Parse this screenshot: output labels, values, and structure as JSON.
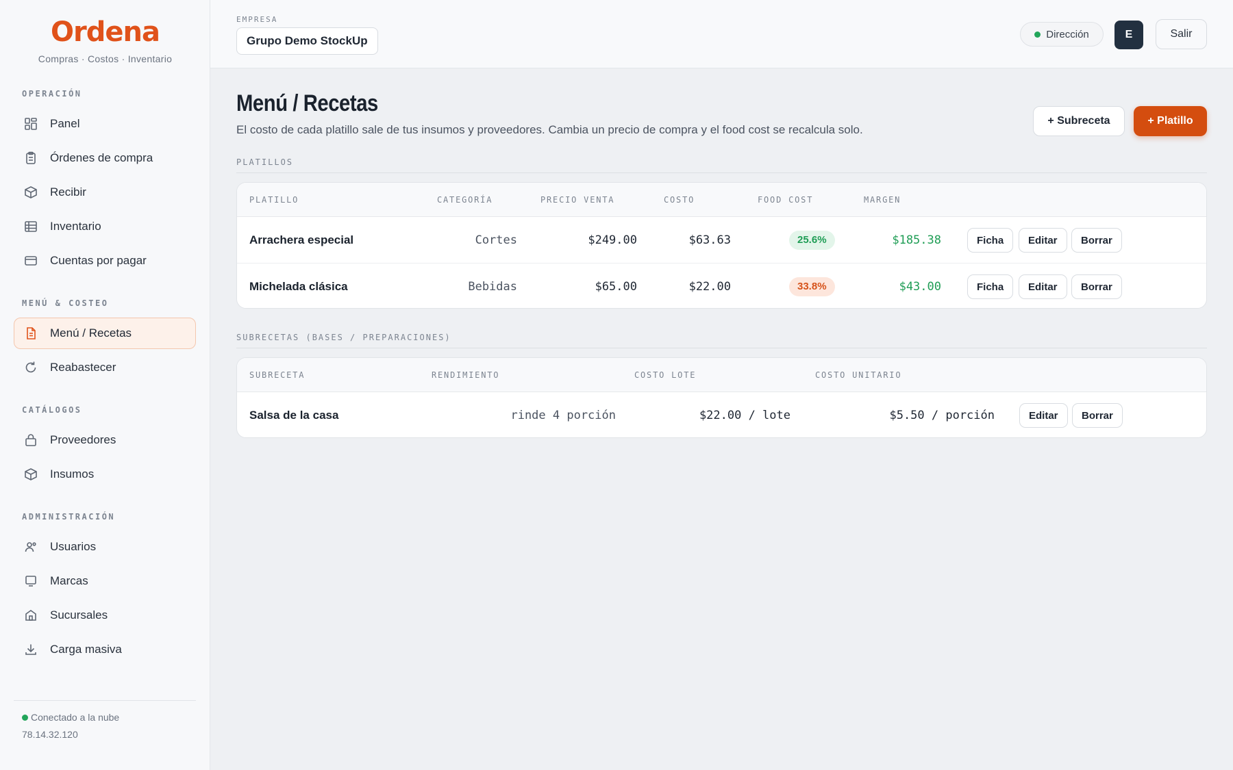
{
  "app": {
    "logo": "Ordena",
    "tagline": "Compras · Costos · Inventario"
  },
  "sidebar": {
    "sections": [
      {
        "label": "OPERACIÓN",
        "items": [
          "Panel",
          "Órdenes de compra",
          "Recibir",
          "Inventario",
          "Cuentas por pagar"
        ]
      },
      {
        "label": "MENÚ & COSTEO",
        "items": [
          "Menú / Recetas",
          "Reabastecer"
        ]
      },
      {
        "label": "CATÁLOGOS",
        "items": [
          "Proveedores",
          "Insumos"
        ]
      },
      {
        "label": "ADMINISTRACIÓN",
        "items": [
          "Usuarios",
          "Marcas",
          "Sucursales",
          "Carga masiva"
        ]
      }
    ],
    "active_item": "Menú / Recetas",
    "status": "Conectado a la nube",
    "ip": "78.14.32.120"
  },
  "topbar": {
    "empresa_label": "EMPRESA",
    "empresa_value": "Grupo Demo StockUp",
    "role": "Dirección",
    "avatar_initial": "E",
    "logout": "Salir"
  },
  "main": {
    "title": "Menú / Recetas",
    "subtitle": "El costo de cada platillo sale de tus insumos y proveedores. Cambia un precio de compra y el food cost se recalcula solo.",
    "add_subrecipe": "+ Subreceta",
    "add_dish": "+ Platillo",
    "dishes": {
      "label": "PLATILLOS",
      "columns": [
        "PLATILLO",
        "CATEGORÍA",
        "PRECIO VENTA",
        "COSTO",
        "FOOD COST",
        "MARGEN"
      ],
      "rows": [
        {
          "name": "Arrachera especial",
          "category": "Cortes",
          "price": "$249.00",
          "cost": "$63.63",
          "food_cost": "25.6%",
          "food_cost_status": "good",
          "margin": "$185.38"
        },
        {
          "name": "Michelada clásica",
          "category": "Bebidas",
          "price": "$65.00",
          "cost": "$22.00",
          "food_cost": "33.8%",
          "food_cost_status": "warn",
          "margin": "$43.00"
        }
      ],
      "actions": [
        "Ficha",
        "Editar",
        "Borrar"
      ]
    },
    "subrecipes": {
      "label": "SUBRECETAS (BASES / PREPARACIONES)",
      "columns": [
        "SUBRECETA",
        "RENDIMIENTO",
        "COSTO LOTE",
        "COSTO UNITARIO"
      ],
      "rows": [
        {
          "name": "Salsa de la casa",
          "yield": "rinde 4 porción",
          "batch_cost": "$22.00 / lote",
          "unit_cost": "$5.50 / porción"
        }
      ],
      "actions": [
        "Editar",
        "Borrar"
      ]
    }
  },
  "colors": {
    "accent": "#e0521a",
    "primary_button": "#d44d0f",
    "success": "#1f9d55",
    "avatar_bg": "#223040"
  }
}
